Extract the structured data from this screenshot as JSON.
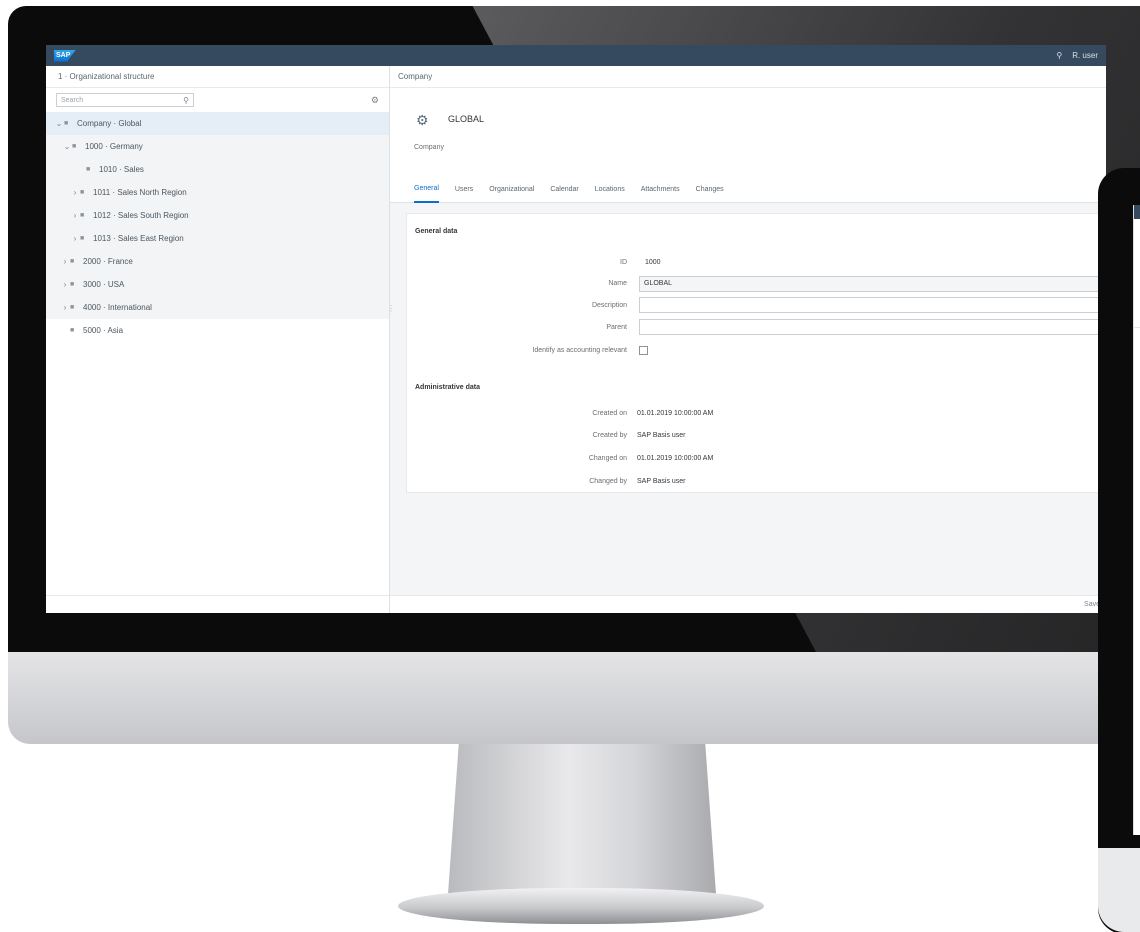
{
  "shell": {
    "logo_text": "SAP",
    "search_icon": "search-icon",
    "user_text": "R. user"
  },
  "left_pane": {
    "header": "1 · Organizational structure",
    "search_placeholder": "Search",
    "tree": [
      {
        "label": "Company · Global",
        "selected": true
      },
      {
        "label": "1000 · Germany"
      },
      {
        "label": "1010 · Sales"
      },
      {
        "label": "1011 · Sales North Region"
      },
      {
        "label": "1012 · Sales South Region"
      },
      {
        "label": "1013 · Sales East Region"
      },
      {
        "label": "2000 · France"
      },
      {
        "label": "3000 · USA"
      },
      {
        "label": "4000 · International"
      },
      {
        "label": "5000 · Asia",
        "plain": true
      }
    ]
  },
  "right_pane": {
    "breadcrumb": "Company",
    "object_title": "GLOBAL",
    "object_subtitle": "Company",
    "tabs": [
      "General",
      "Users",
      "Organizational",
      "Calendar",
      "Locations",
      "Attachments",
      "Changes"
    ],
    "section_general": "General data",
    "fields": {
      "id_label": "ID",
      "id_value": "1000",
      "name_label": "Name",
      "name_value": "GLOBAL",
      "description_label": "Description",
      "parent_label": "Parent",
      "flag_label": "Identify as accounting relevant"
    },
    "section_admin": "Administrative data",
    "admin": [
      {
        "label": "Created on",
        "value": "01.01.2019 10:00:00 AM"
      },
      {
        "label": "Created by",
        "value": "SAP Basis user"
      },
      {
        "label": "Changed on",
        "value": "01.01.2019 10:00:00 AM"
      },
      {
        "label": "Changed by",
        "value": "SAP Basis user"
      }
    ],
    "footer_text": "Save"
  }
}
